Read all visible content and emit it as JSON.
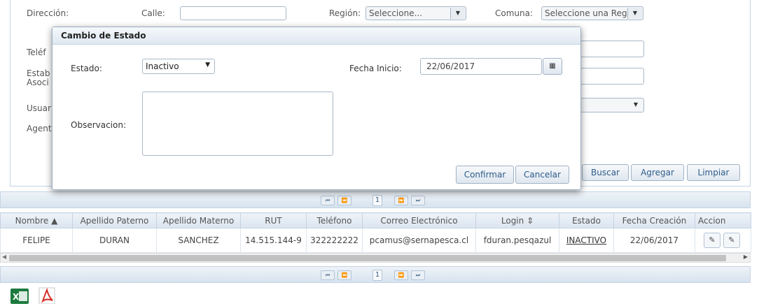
{
  "filter": {
    "direccion_label": "Dirección:",
    "calle_label": "Calle:",
    "region_label": "Región:",
    "region_value": "Seleccione...",
    "comuna_label": "Comuna:",
    "comuna_value": "Seleccione una Reg",
    "telefono_label": "Teléf",
    "establecimiento_label_1": "Estab",
    "establecimiento_label_2": "Asoci",
    "usuario_label": "Usuar",
    "agente_label": "Agent",
    "buttons": {
      "buscar": "Buscar",
      "agregar": "Agregar",
      "limpiar": "Limpiar"
    }
  },
  "modal": {
    "title": "Cambio de Estado",
    "estado_label": "Estado:",
    "estado_value": "Inactivo",
    "fecha_inicio_label": "Fecha Inicio:",
    "fecha_inicio_value": "22/06/2017",
    "observacion_label": "Observacion:",
    "confirm_label": "Confirmar",
    "cancel_label": "Cancelar"
  },
  "pager": {
    "first": "⏮",
    "prev": "⏪",
    "page": "1",
    "next": "⏩",
    "last": "⏭"
  },
  "grid": {
    "columns": [
      "Nombre ▲",
      "Apellido Paterno",
      "Apellido Materno",
      "RUT",
      "Teléfono",
      "Correo Electrónico",
      "Login ⇕",
      "Estado",
      "Fecha Creación",
      "Accion"
    ],
    "rows": [
      [
        "FELIPE",
        "DURAN",
        "SANCHEZ",
        "14.515.144-9",
        "322222222",
        "pcamus@sernapesca.cl",
        "fduran.pesqazul",
        "INACTIVO",
        "22/06/2017"
      ]
    ]
  },
  "export": {
    "excel_icon": "excel-icon",
    "pdf_icon": "pdf-icon"
  }
}
